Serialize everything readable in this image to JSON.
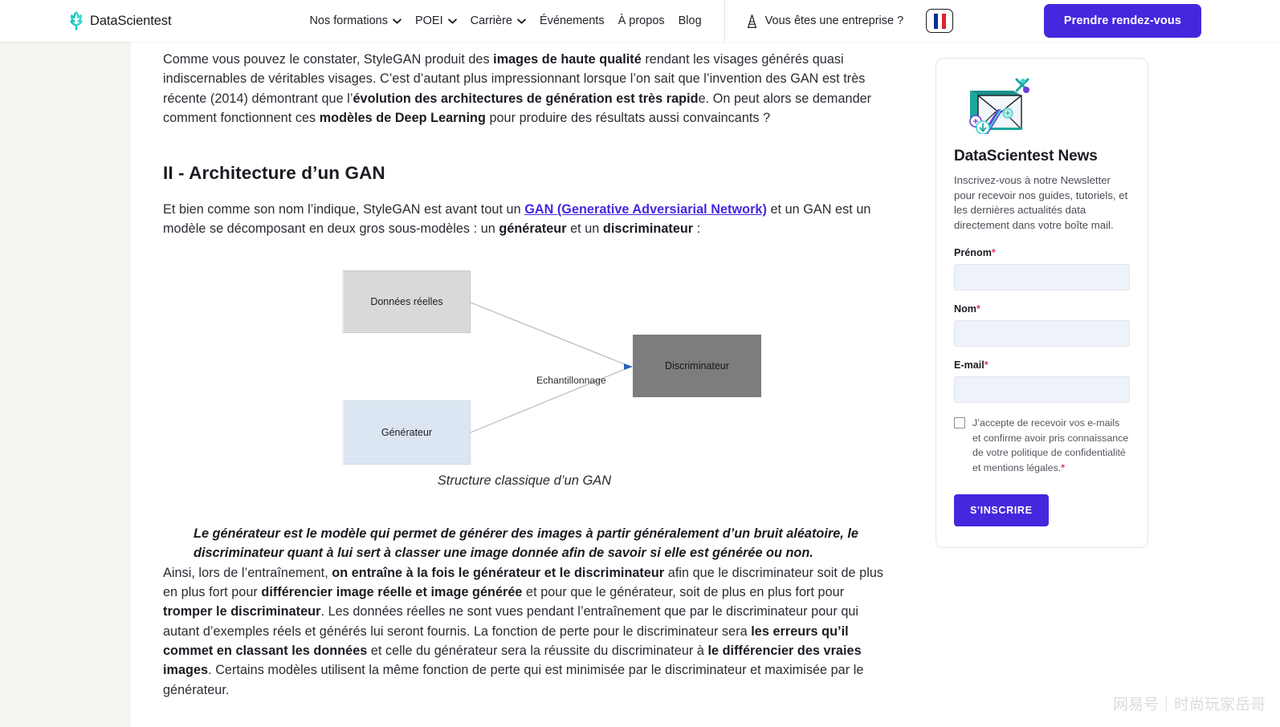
{
  "header": {
    "logo_text": "DataScientest",
    "logo_icon": "datascientest-logo-icon",
    "nav": [
      {
        "label": "Nos formations",
        "has_dropdown": true
      },
      {
        "label": "POEI",
        "has_dropdown": true
      },
      {
        "label": "Carrière",
        "has_dropdown": true
      },
      {
        "label": "Événements",
        "has_dropdown": false
      },
      {
        "label": "À propos",
        "has_dropdown": false
      },
      {
        "label": "Blog",
        "has_dropdown": false
      }
    ],
    "enterprise_label": "Vous êtes une entreprise ?",
    "enterprise_icon": "building-icon",
    "language_flag": "fr-flag-icon",
    "cta_label": "Prendre rendez-vous",
    "accent_color": "#4627dd"
  },
  "article": {
    "intro_paragraph": {
      "p1": "Comme vous pouvez le constater, StyleGAN produit des ",
      "b1": "images de haute qualité",
      "p2": " rendant les visages générés quasi indiscernables de véritables visages. C’est d’autant plus impressionnant lorsque l’on sait que l’invention des GAN est très récente (2014) démontrant que l’",
      "b2": "évolution des architectures de génération est très rapid",
      "p3": "e. On peut alors se demander comment fonctionnent ces ",
      "b3": "modèles de Deep Learning",
      "p4": " pour produire des résultats aussi convaincants ?"
    },
    "section_title": "II - Architecture d’un GAN",
    "section_paragraph": {
      "p1": "Et bien comme son nom l’indique, StyleGAN est avant tout un ",
      "link": "GAN (Generative Adversiarial Network)",
      "p2": " et un GAN est un modèle se décomposant en deux gros sous-modèles : un ",
      "b1": "générateur",
      "p3": " et un ",
      "b2": "discriminateur",
      "p4": " :"
    },
    "diagram": {
      "box_real": "Données réelles",
      "box_generator": "Générateur",
      "box_discriminator": "Discriminateur",
      "edge_label": "Echantillonnage",
      "caption": "Structure classique d’un GAN",
      "colors": {
        "real": "#d9d9d9",
        "generator": "#dce6f2",
        "discriminator": "#7d7d7d"
      }
    },
    "callout": "Le générateur est le modèle qui permet de générer des images à partir généralement d’un bruit aléatoire, le discriminateur quant à lui sert à classer une image donnée afin de savoir si elle est générée ou non.",
    "final_paragraph": {
      "p1": "Ainsi, lors de l’entraînement, ",
      "b1": "on entraîne à la fois le générateur et le discriminateur",
      "p2": " afin que le discriminateur soit de plus en plus fort pour ",
      "b2": "différencier image réelle et image générée",
      "p3": " et pour que le générateur, soit de plus en plus fort pour ",
      "b3": "tromper le discriminateur",
      "p4": ". Les données réelles ne sont vues pendant l’entraînement que par le discriminateur pour qui autant d’exemples réels et générés lui seront fournis. La fonction de perte pour le discriminateur sera ",
      "b4": "les erreurs qu’il commet en classant les données",
      "p5": " et celle du générateur sera la réussite du discriminateur à ",
      "b5": "le différencier des vraies images",
      "p6": ". Certains modèles utilisent la même fonction de perte qui est minimisée par le discriminateur et maximisée par le générateur."
    }
  },
  "newsletter": {
    "illustration": "envelope-newsletter-icon",
    "title": "DataScientest News",
    "description": "Inscrivez-vous à notre Newsletter pour recevoir nos guides, tutoriels, et les dernières actualités data directement dans votre boîte mail.",
    "fields": [
      {
        "label": "Prénom",
        "required": "*",
        "value": "",
        "placeholder": ""
      },
      {
        "label": "Nom",
        "required": "*",
        "value": "",
        "placeholder": ""
      },
      {
        "label": "E-mail",
        "required": "*",
        "value": "",
        "placeholder": ""
      }
    ],
    "consent_text": "J’accepte de recevoir vos e-mails et confirme avoir pris connaissance de votre politique de confidentialité et mentions légales.",
    "consent_required": "*",
    "consent_checked": false,
    "submit_label": "S'INSCRIRE",
    "accent_color": "#4627dd",
    "required_color": "#e0396d"
  },
  "watermark": {
    "left": "网易号",
    "right": "时尚玩家岳哥"
  }
}
